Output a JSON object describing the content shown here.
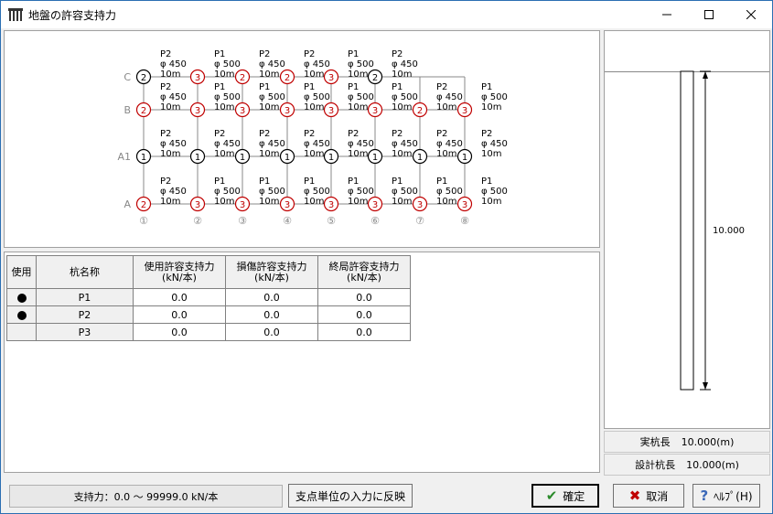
{
  "window": {
    "title": "地盤の許容支持力"
  },
  "plan": {
    "rows": [
      "C",
      "B",
      "A1",
      "A"
    ],
    "cols": [
      "①",
      "②",
      "③",
      "④",
      "⑤",
      "⑥",
      "⑦",
      "⑧"
    ],
    "pile_types": {
      "1": "A1",
      "2": "P2",
      "3": "P1"
    },
    "labels": {
      "P1": [
        "P1",
        "φ 500",
        "10m"
      ],
      "P2": [
        "P2",
        "φ 450",
        "10m"
      ]
    },
    "nodes": {
      "C": [
        "2",
        "3",
        "2",
        "2",
        "3",
        "2"
      ],
      "B": [
        "2",
        "3",
        "3",
        "3",
        "3",
        "3",
        "2",
        "3"
      ],
      "A1": [
        "1",
        "1",
        "1",
        "1",
        "1",
        "1",
        "1",
        "1"
      ],
      "A": [
        "2",
        "3",
        "3",
        "3",
        "3",
        "3",
        "3",
        "3"
      ]
    },
    "node_colors": {
      "red": "#c00000",
      "black": "#000000"
    }
  },
  "table": {
    "headers": [
      "使用",
      "杭名称",
      "使用許容支持力\n(kN/本)",
      "損傷許容支持力\n(kN/本)",
      "終局許容支持力\n(kN/本)"
    ],
    "rows": [
      {
        "used": true,
        "name": "P1",
        "v1": "0.0",
        "v2": "0.0",
        "v3": "0.0"
      },
      {
        "used": true,
        "name": "P2",
        "v1": "0.0",
        "v2": "0.0",
        "v3": "0.0"
      },
      {
        "used": false,
        "name": "P3",
        "v1": "0.0",
        "v2": "0.0",
        "v3": "0.0"
      }
    ]
  },
  "pile_view": {
    "length_label": "10.000"
  },
  "info": {
    "actual_label": "実杭長",
    "actual_value": "10.000(m)",
    "design_label": "設計杭長",
    "design_value": "10.000(m)"
  },
  "status": {
    "range_text": "支持力：0.0 ～ 99999.0 kN/本"
  },
  "buttons": {
    "reflect": "支点単位の入力に反映",
    "ok": "確定",
    "cancel": "取消",
    "help": "ﾍﾙﾌﾟ(H)"
  }
}
